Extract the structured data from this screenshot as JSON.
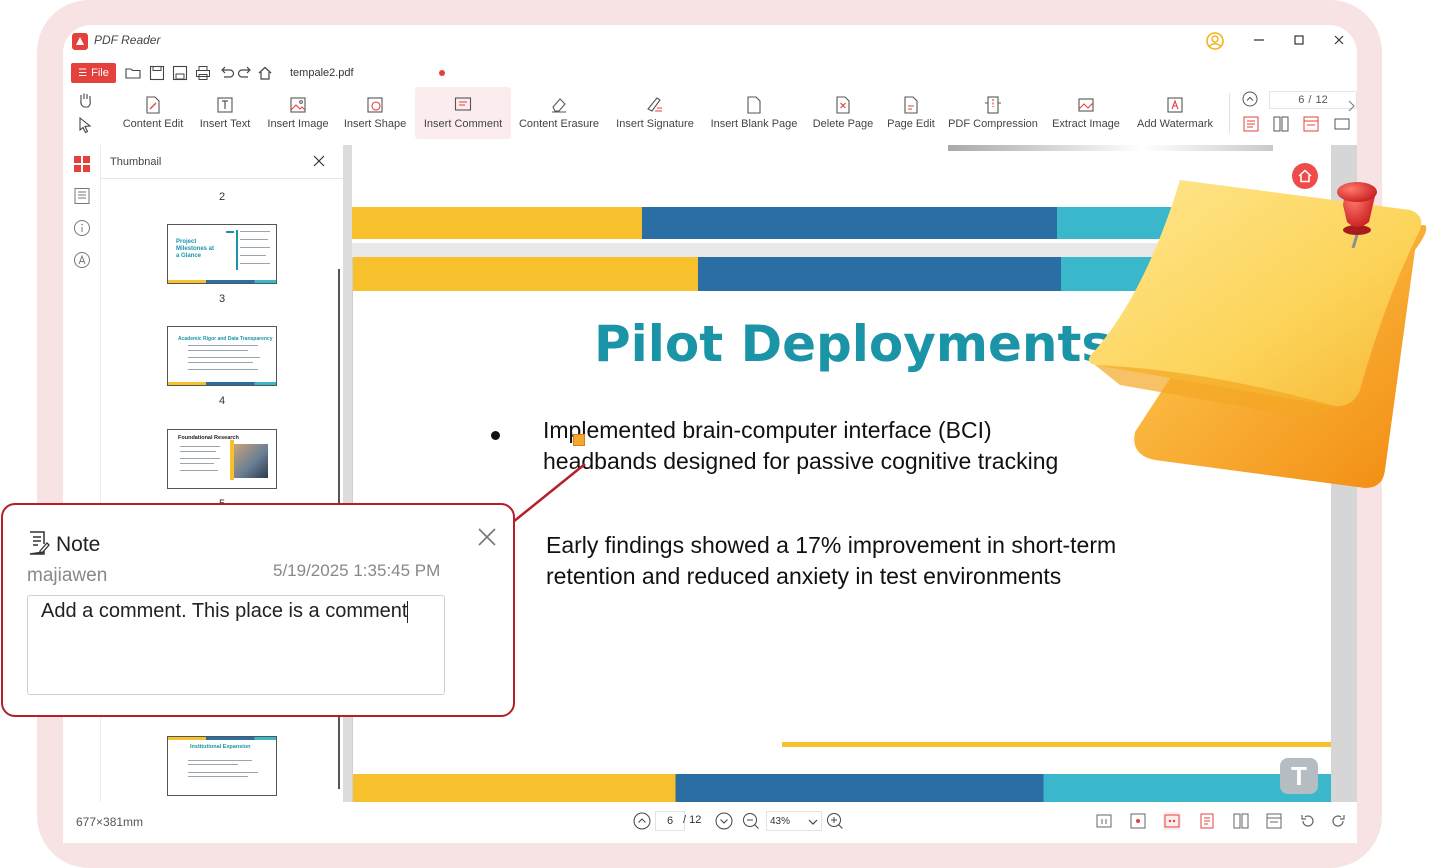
{
  "app": {
    "name": "PDF Reader",
    "file_label": "File",
    "document_tab": "tempale2.pdf",
    "accent": "#e5413c"
  },
  "ribbon": {
    "tools": [
      {
        "label": "Content Edit",
        "icon": "content-edit-icon"
      },
      {
        "label": "Insert Text",
        "icon": "insert-text-icon"
      },
      {
        "label": "Insert Image",
        "icon": "insert-image-icon"
      },
      {
        "label": "Insert Shape",
        "icon": "insert-shape-icon"
      },
      {
        "label": "Insert Comment",
        "icon": "insert-comment-icon",
        "active": true
      },
      {
        "label": "Content Erasure",
        "icon": "eraser-icon"
      },
      {
        "label": "Insert Signature",
        "icon": "signature-icon"
      },
      {
        "label": "Insert Blank Page",
        "icon": "blank-page-icon"
      },
      {
        "label": "Delete Page",
        "icon": "delete-page-icon"
      },
      {
        "label": "Page Edit",
        "icon": "page-edit-icon"
      },
      {
        "label": "PDF Compression",
        "icon": "compression-icon"
      },
      {
        "label": "Extract Image",
        "icon": "extract-image-icon"
      },
      {
        "label": "Add Watermark",
        "icon": "watermark-icon"
      }
    ],
    "page_indicator": {
      "current": "6",
      "separator": "/",
      "total": "12"
    }
  },
  "thumbnail_panel": {
    "title": "Thumbnail",
    "page_numbers": [
      "2",
      "3",
      "4",
      "5"
    ],
    "thumbs": [
      {
        "title": "Project Milestones at a Glance"
      },
      {
        "title": "Academic Rigor and Data Transparency"
      },
      {
        "title": "Foundational Research"
      },
      {
        "title": "Institutional Expansion"
      }
    ]
  },
  "page": {
    "title": "Pilot Deployments",
    "bullet_line1": "Implemented brain-computer interface (BCI)",
    "bullet_line2": "headbands designed for passive cognitive tracking",
    "para_line1": "Early findings showed a 17% improvement in short-term",
    "para_line2": "retention and reduced anxiety in test environments",
    "brand_colors": {
      "yellow": "#f6c12d",
      "blue": "#2b6ea4",
      "teal": "#3bb7cb",
      "title": "#1b94a8"
    },
    "badge_letter": "T"
  },
  "note": {
    "title": "Note",
    "author": "majiawen",
    "date": "5/19/2025 1:35:45 PM",
    "text": "Add a comment. This place is a comment",
    "border_color": "#b3202a"
  },
  "status": {
    "dimensions": "677×381mm",
    "page_current": "6",
    "page_total": "/ 12",
    "zoom": "43%"
  }
}
